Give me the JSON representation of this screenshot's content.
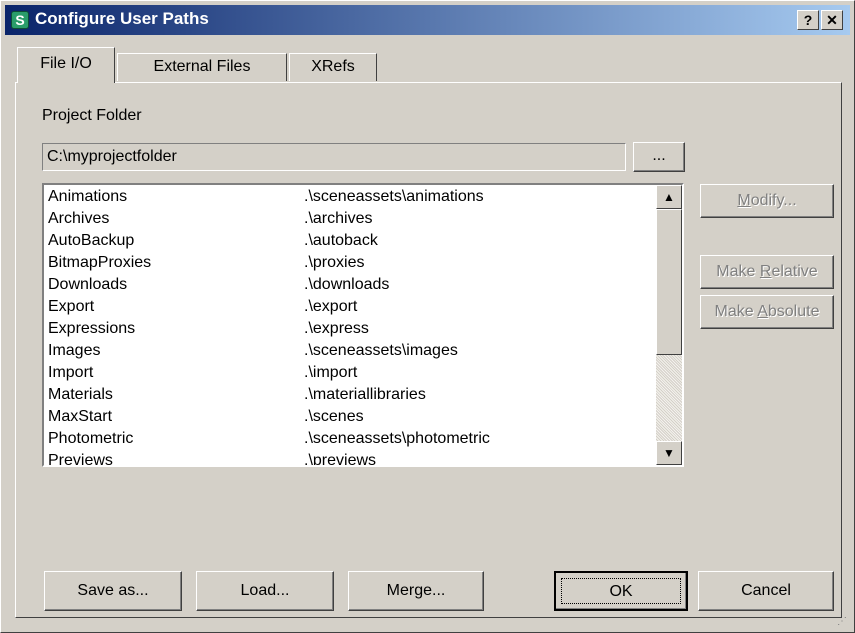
{
  "window": {
    "title": "Configure User Paths",
    "help_label": "?",
    "close_label": "✕",
    "icon_glyph": "S"
  },
  "tabs": [
    {
      "label": "File I/O",
      "active": true
    },
    {
      "label": "External Files",
      "active": false
    },
    {
      "label": "XRefs",
      "active": false
    }
  ],
  "project_folder": {
    "label": "Project Folder",
    "value": "C:\\myprojectfolder",
    "browse_label": "..."
  },
  "paths": [
    {
      "name": "Animations",
      "path": ".\\sceneassets\\animations"
    },
    {
      "name": "Archives",
      "path": ".\\archives"
    },
    {
      "name": "AutoBackup",
      "path": ".\\autoback"
    },
    {
      "name": "BitmapProxies",
      "path": ".\\proxies"
    },
    {
      "name": "Downloads",
      "path": ".\\downloads"
    },
    {
      "name": "Export",
      "path": ".\\export"
    },
    {
      "name": "Expressions",
      "path": ".\\express"
    },
    {
      "name": "Images",
      "path": ".\\sceneassets\\images"
    },
    {
      "name": "Import",
      "path": ".\\import"
    },
    {
      "name": "Materials",
      "path": ".\\materiallibraries"
    },
    {
      "name": "MaxStart",
      "path": ".\\scenes"
    },
    {
      "name": "Photometric",
      "path": ".\\sceneassets\\photometric"
    },
    {
      "name": "Previews",
      "path": ".\\previews"
    }
  ],
  "side_buttons": {
    "modify": {
      "pre": "",
      "key": "M",
      "post": "odify..."
    },
    "make_relative": {
      "pre": "Make ",
      "key": "R",
      "post": "elative"
    },
    "make_absolute": {
      "pre": "Make ",
      "key": "A",
      "post": "bsolute"
    }
  },
  "buttons": {
    "save_as": "Save as...",
    "load": "Load...",
    "merge": "Merge...",
    "ok": "OK",
    "cancel": "Cancel"
  },
  "scroll": {
    "up": "▲",
    "down": "▼"
  },
  "colors": {
    "face": "#d4d0c8",
    "title_start": "#0a246a",
    "title_end": "#a6caf0",
    "disabled_text": "#808080"
  }
}
